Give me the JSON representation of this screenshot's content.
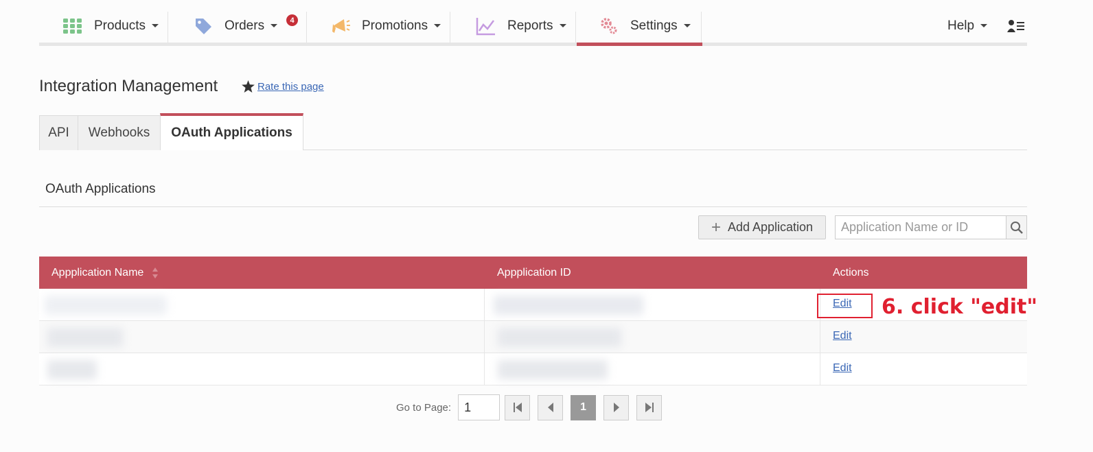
{
  "nav": {
    "items": [
      {
        "label": "Products",
        "icon": "grid-icon"
      },
      {
        "label": "Orders",
        "icon": "tag-icon",
        "badge": "4"
      },
      {
        "label": "Promotions",
        "icon": "megaphone-icon"
      },
      {
        "label": "Reports",
        "icon": "chart-icon"
      },
      {
        "label": "Settings",
        "icon": "gear-icon",
        "active": true
      }
    ],
    "help": "Help",
    "account_icon": "user-menu-icon",
    "accent_color": "#c24f5b"
  },
  "page": {
    "title": "Integration Management",
    "rate_link": "Rate this page"
  },
  "tabs": [
    {
      "label": "API"
    },
    {
      "label": "Webhooks"
    },
    {
      "label": "OAuth Applications",
      "active": true
    }
  ],
  "section": {
    "title": "OAuth Applications",
    "add_button": "Add Application",
    "search_placeholder": "Application Name or ID"
  },
  "table": {
    "headers": [
      "Appplication Name",
      "Appplication ID",
      "Actions"
    ],
    "rows": [
      {
        "name": "",
        "id": "",
        "action": "Edit"
      },
      {
        "name": "",
        "id": "",
        "action": "Edit"
      },
      {
        "name": "",
        "id": "",
        "action": "Edit"
      }
    ]
  },
  "annotation": "6. click \"edit\"",
  "pager": {
    "label": "Go to Page:",
    "page_value": "1",
    "current": "1"
  }
}
